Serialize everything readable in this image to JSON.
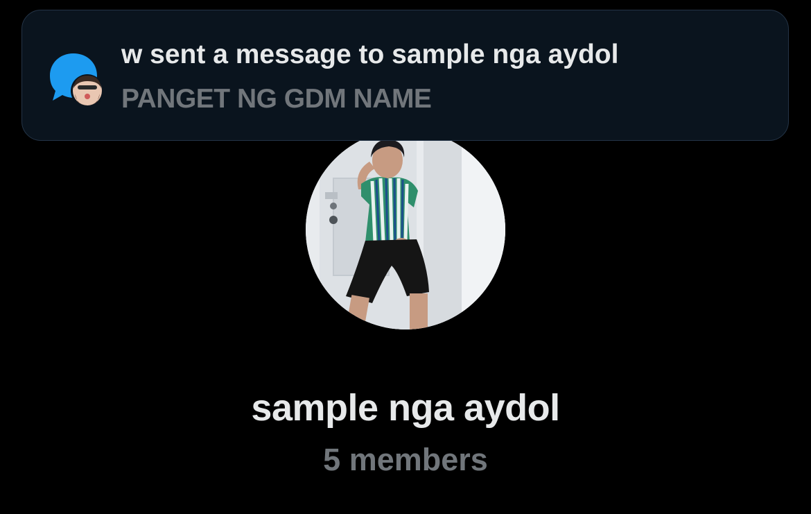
{
  "notification": {
    "icon": "message-bubble-icon",
    "title": "w sent a message to sample nga aydol",
    "message": "PANGET NG GDM NAME",
    "accent_color": "#1d9bf0"
  },
  "group": {
    "name": "sample nga aydol",
    "members": "5 members"
  }
}
